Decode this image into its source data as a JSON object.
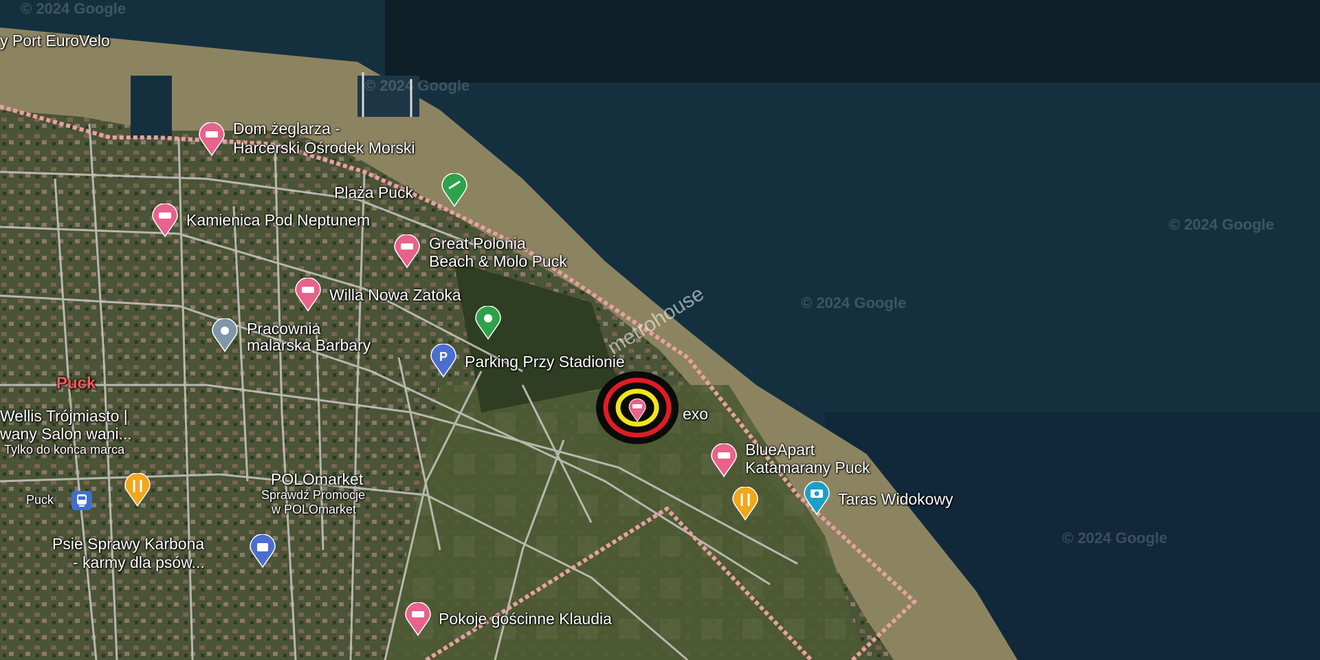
{
  "map": {
    "watermarks": {
      "google": "© 2024 Google",
      "metrohouse": "metrohouse"
    },
    "places": {
      "port_eurovelo": "y Port EuroVelo",
      "dom_zeglarza_1": "Dom żeglarza -",
      "dom_zeglarza_2": "Harcerski Ośrodek Morski",
      "plaza_puck": "Plaża Puck",
      "kamienica": "Kamienica Pod Neptunem",
      "great_polonia_1": "Great Polonia",
      "great_polonia_2": "Beach & Molo Puck",
      "willa": "Willa Nowa Zatoka",
      "pracownia_1": "Pracownia",
      "pracownia_2": "malarska Barbary",
      "parking": "Parking Przy Stadionie",
      "puck_city": "Puck",
      "wellis_1": "Wellis Trójmiasto |",
      "wellis_2": "wany Salon wani...",
      "wellis_3": "Tylko do końca marca",
      "puck_station": "Puck",
      "polomarket_1": "POLOmarket",
      "polomarket_2": "Sprawdź Promocje",
      "polomarket_3": "w POLOmarket",
      "psie_1": "Psie Sprawy Karbona",
      "psie_2": "- karmy dla psów...",
      "exo": "exo",
      "blueapart_1": "BlueApart",
      "blueapart_2": "Katamarany Puck",
      "taras": "Taras Widokowy",
      "pokoje": "Pokoje gościnne Klaudia"
    }
  },
  "colors": {
    "sea": "#14303f",
    "shallow": "#8c8461",
    "land": "#3e4a2e",
    "road": "#c9c9c4",
    "hotel_pin": "#e8628c",
    "green_pin": "#2da24a",
    "gray_pin": "#7f97a8",
    "parking_pin": "#4b6fd1",
    "food_pin": "#f2a61b",
    "camera_pin": "#1aa0c8",
    "boundary": "#e8a0a0",
    "city_label": "#ff5a4e"
  },
  "icons": [
    "hotel-pin-icon",
    "beach-pin-icon",
    "place-pin-icon",
    "parking-pin-icon",
    "restaurant-pin-icon",
    "viewpoint-pin-icon",
    "shopping-pin-icon",
    "train-station-icon",
    "target-marker-icon"
  ]
}
